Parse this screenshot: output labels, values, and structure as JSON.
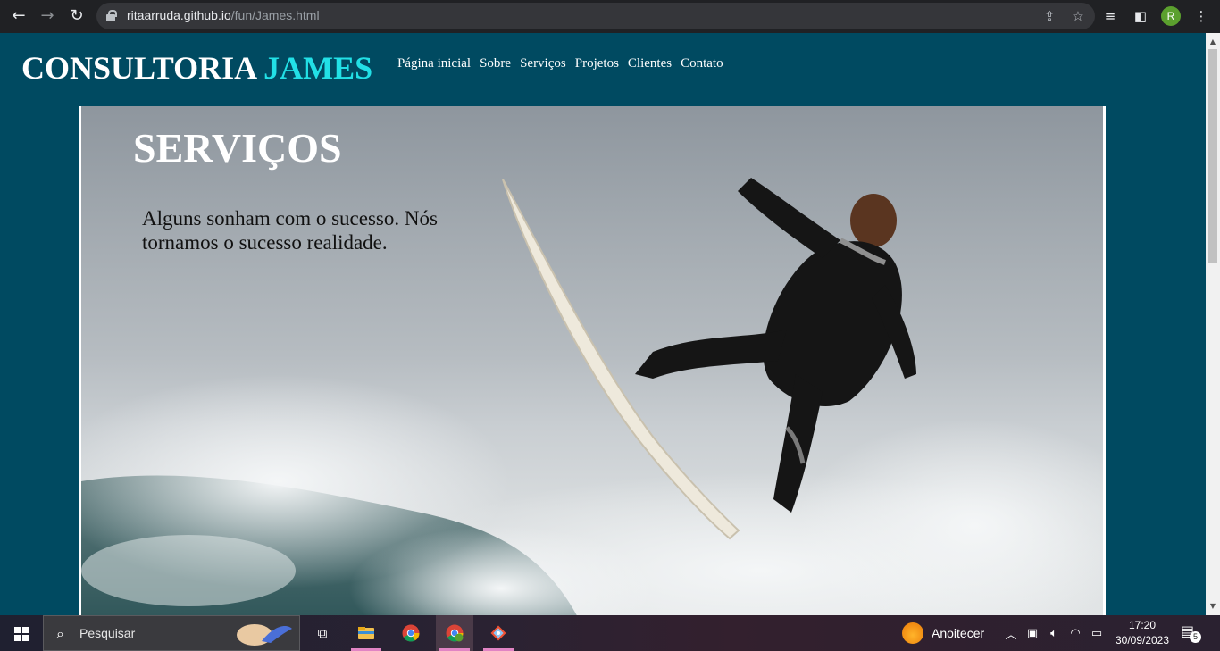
{
  "browser": {
    "url_host": "ritaarruda.github.io",
    "url_path": "/fun/James.html",
    "profile_initial": "R",
    "icons": [
      "back-arrow-icon",
      "forward-arrow-icon",
      "reload-icon",
      "lock-icon",
      "share-icon",
      "bookmark-star-icon",
      "media-queue-icon",
      "side-panel-icon",
      "menu-dots-icon"
    ]
  },
  "site": {
    "brand_main": "CONSULTORIA",
    "brand_accent": "JAMES",
    "accent_color": "#22e0e6",
    "background_color": "#004a61",
    "nav": [
      "Página inicial",
      "Sobre",
      "Serviços",
      "Projetos",
      "Clientes",
      "Contato"
    ]
  },
  "hero": {
    "title": "SERVIÇOS",
    "text": "Alguns sonham com o sucesso. Nós tornamos o sucesso realidade.",
    "image": "surfer-on-wave-image"
  },
  "taskbar": {
    "search_placeholder": "Pesquisar",
    "weather_label": "Anoitecer",
    "time": "17:20",
    "date": "30/09/2023",
    "notification_count": "5",
    "apps": [
      "task-view-icon",
      "file-explorer-icon",
      "chrome-icon",
      "chrome-profile-icon",
      "git-icon"
    ]
  }
}
